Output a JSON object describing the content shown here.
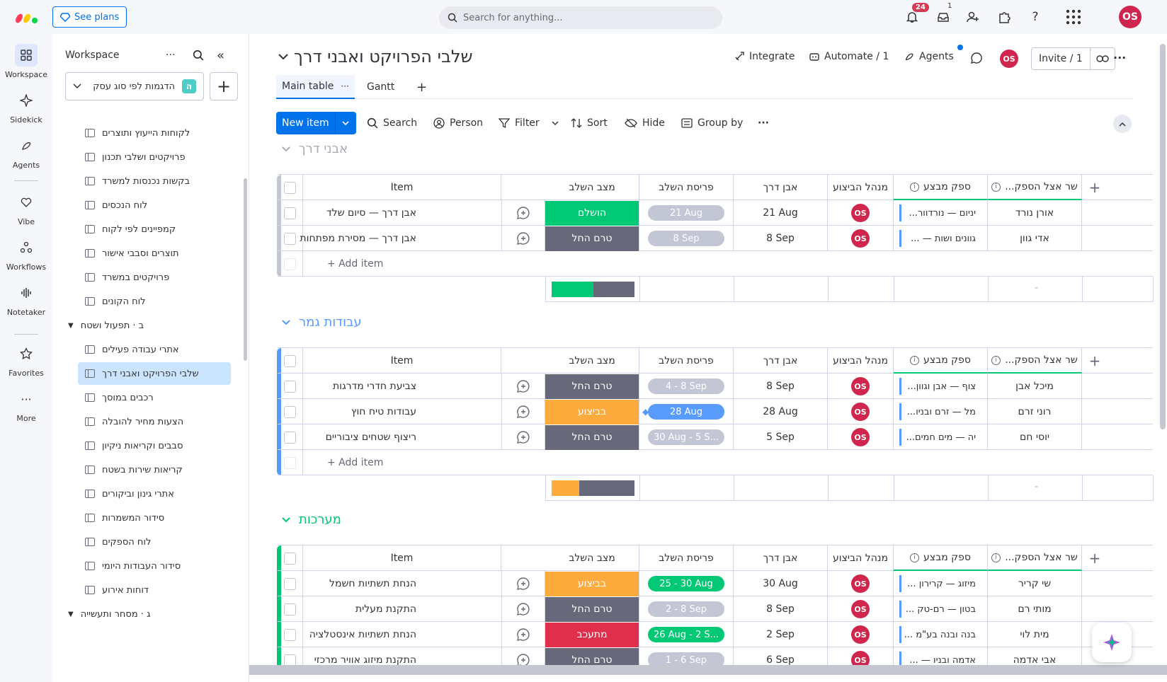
{
  "topbar": {
    "see_plans": "See plans",
    "search_placeholder": "Search for anything...",
    "notifications_count": "24",
    "inbox_count": "1",
    "avatar": "OS"
  },
  "rail": [
    {
      "label": "Workspace",
      "icon": "grid-icon"
    },
    {
      "label": "Sidekick",
      "icon": "sparkle-icon"
    },
    {
      "label": "Agents",
      "icon": "agents-icon"
    },
    {
      "label": "Vibe",
      "icon": "heart-icon"
    },
    {
      "label": "Workflows",
      "icon": "workflows-icon"
    },
    {
      "label": "Notetaker",
      "icon": "waveform-icon"
    },
    {
      "label": "Favorites",
      "icon": "star-icon"
    },
    {
      "label": "More",
      "icon": "more-icon"
    }
  ],
  "workspace": {
    "title": "Workspace",
    "selected_workspace": "הדגמות לפי סוג עסק",
    "workspace_letter": "ה",
    "items": [
      "לקוחות הייעוץ ותוצרים",
      "פרויקטים ושלבי תכנון",
      "בקשות נכנסות למשרד",
      "לוח הנכסים",
      "קמפיינים לפי לקוח",
      "תוצרים וסבבי אישור",
      "פרויקטים במשרד",
      "לוח הקונים"
    ],
    "folder_b": "ב · תפעול ושטח",
    "items_b": [
      "אתרי עבודה פעילים",
      "שלבי הפרויקט ואבני דרך",
      "רכבים במוסך",
      "הצעות מחיר להובלה",
      "סבבים וקריאות ניקיון",
      "קריאות שירות בשטח",
      "אתרי גינון וביקורים",
      "סידור המשמרות",
      "לוח הספקים",
      "סידור העבודות היומי",
      "דוחות אירוע"
    ],
    "folder_c": "ג · מסחר ותעשייה"
  },
  "board": {
    "title": "שלבי הפרויקט ואבני דרך",
    "integrate": "Integrate",
    "automate": "Automate / 1",
    "agents": "Agents",
    "invite": "Invite / 1",
    "tab_main": "Main table",
    "tab_gantt": "Gantt",
    "tab_add": "+"
  },
  "toolbar": {
    "new_item": "New item",
    "search": "Search",
    "person": "Person",
    "filter": "Filter",
    "sort": "Sort",
    "hide": "Hide",
    "group_by": "Group by"
  },
  "columns": {
    "item": "Item",
    "status": "מצב השלב",
    "timeline": "פריסת השלב",
    "milestone": "אבן דרך",
    "manager": "מנהל הביצוע",
    "supplier": "ספק מבצע",
    "contact": "...שר אצל הספק",
    "add_item": "+ Add item"
  },
  "colors": {
    "done": "#00c875",
    "not_started": "#676879",
    "working": "#fdab3d",
    "stuck": "#df2f4a",
    "blue": "#579bfc",
    "green": "#00c875"
  },
  "groups": [
    {
      "title": "אבני דרך",
      "color": "#c3c6d4",
      "rows": [
        {
          "item": "אבן דרך — סיום שלד",
          "status": "הושלם",
          "status_color": "#00c875",
          "timeline": "21 Aug",
          "tl_color": "#c3c6d4",
          "milestone": "21 Aug",
          "supplier": "...יניום — נורדוור",
          "contact": "אורן נורד"
        },
        {
          "item": "אבן דרך — מסירת מפתחות",
          "status": "טרם החל",
          "status_color": "#676879",
          "timeline": "8 Sep",
          "tl_color": "#c3c6d4",
          "milestone": "8 Sep",
          "supplier": "... — גוונים ושות",
          "contact": "אדי גוון"
        }
      ],
      "summary": [
        {
          "color": "#00c875",
          "pct": 50
        },
        {
          "color": "#676879",
          "pct": 50
        }
      ]
    },
    {
      "title": "עבודות גמר",
      "color": "#579bfc",
      "rows": [
        {
          "item": "צביעת חדרי מדרגות",
          "status": "טרם החל",
          "status_color": "#676879",
          "timeline": "4 - 8 Sep",
          "tl_color": "#c3c6d4",
          "milestone": "8 Sep",
          "supplier": "...צוף — אבן וגוון",
          "contact": "מיכל אבן"
        },
        {
          "item": "עבודות טיח חוץ",
          "status": "בביצוע",
          "status_color": "#fdab3d",
          "timeline": "28 Aug",
          "tl_color": "#579bfc",
          "milestone": "28 Aug",
          "supplier": "...מל — זרם ובניו",
          "contact": "רוני זרם"
        },
        {
          "item": "ריצוף שטחים ציבוריים",
          "status": "טרם החל",
          "status_color": "#676879",
          "timeline": "30 Aug - 5 S...",
          "tl_color": "#c3c6d4",
          "milestone": "5 Sep",
          "supplier": "...יה — מים חמים",
          "contact": "יוסי חם"
        }
      ],
      "summary": [
        {
          "color": "#fdab3d",
          "pct": 33
        },
        {
          "color": "#676879",
          "pct": 67
        }
      ]
    },
    {
      "title": "מערכות",
      "color": "#00c875",
      "rows": [
        {
          "item": "הנחת תשתיות חשמל",
          "status": "בביצוע",
          "status_color": "#fdab3d",
          "timeline": "25 - 30 Aug",
          "tl_color": "#00c875",
          "milestone": "30 Aug",
          "supplier": "... מיזוג — קרירון",
          "contact": "שי קריר"
        },
        {
          "item": "התקנת מעלית",
          "status": "טרם החל",
          "status_color": "#676879",
          "timeline": "2 - 8 Sep",
          "tl_color": "#c3c6d4",
          "milestone": "8 Sep",
          "supplier": "... בטון — רם-טק",
          "contact": "מותי רם"
        },
        {
          "item": "הנחת תשתיות אינסטלציה",
          "status": "מתעכב",
          "status_color": "#df2f4a",
          "timeline": "26 Aug - 2 S...",
          "tl_color": "#00c875",
          "milestone": "2 Sep",
          "supplier": "... בנה ובנה בע\"מ",
          "contact": "מית לוי"
        },
        {
          "item": "התקנת מיזוג אוויר מרכזי",
          "status": "טרם החל",
          "status_color": "#676879",
          "timeline": "1 - 6 Sep",
          "tl_color": "#c3c6d4",
          "milestone": "6 Sep",
          "supplier": "... — אדמה ובניו",
          "contact": "אבי אדמה"
        }
      ]
    }
  ]
}
